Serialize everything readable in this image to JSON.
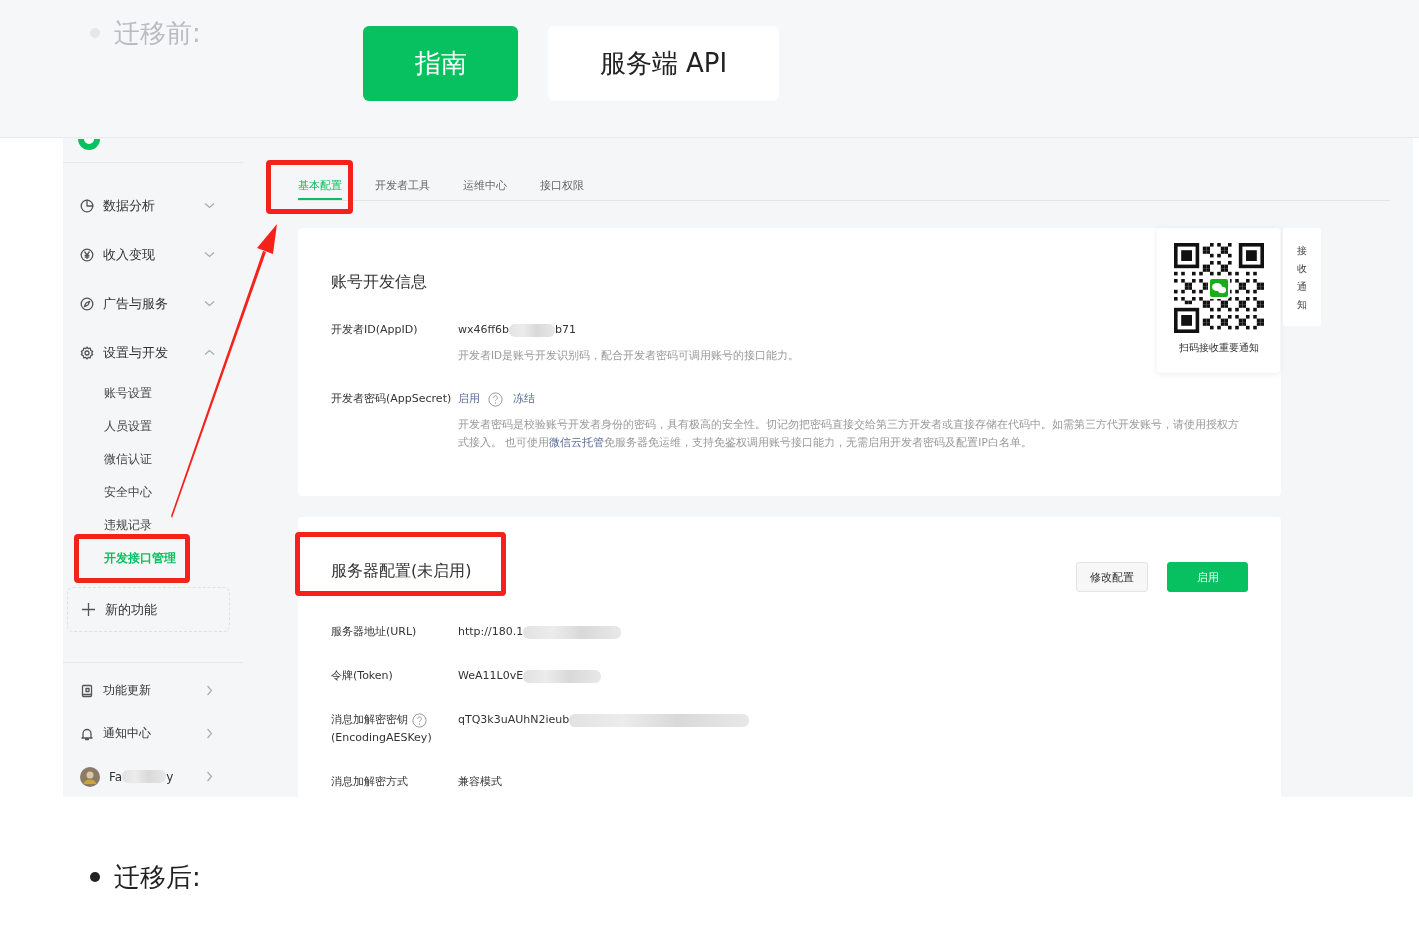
{
  "doc": {
    "bullet_before": "迁移前:",
    "bullet_after": "迁移后:"
  },
  "header_tabs": [
    {
      "label": "指南",
      "selected": true
    },
    {
      "label": "服务端 API",
      "selected": false
    }
  ],
  "screenshot": {
    "nav": [
      {
        "label": "数据分析",
        "expanded": false
      },
      {
        "label": "收入变现",
        "expanded": false
      },
      {
        "label": "广告与服务",
        "expanded": false
      },
      {
        "label": "设置与开发",
        "expanded": true,
        "children": [
          {
            "label": "账号设置",
            "selected": false
          },
          {
            "label": "人员设置",
            "selected": false
          },
          {
            "label": "微信认证",
            "selected": false
          },
          {
            "label": "安全中心",
            "selected": false
          },
          {
            "label": "违规记录",
            "selected": false
          },
          {
            "label": "开发接口管理",
            "selected": true
          }
        ]
      }
    ],
    "new_feature": "新的功能",
    "footer_nav": [
      {
        "kind": "book",
        "label": "功能更新"
      },
      {
        "kind": "bell",
        "label": "通知中心"
      },
      {
        "kind": "avatar",
        "label": "Fa",
        "label_end": "y",
        "redacted": true
      }
    ],
    "tabs": [
      {
        "label": "基本配置",
        "selected": true
      },
      {
        "label": "开发者工具",
        "selected": false
      },
      {
        "label": "运维中心",
        "selected": false
      },
      {
        "label": "接口权限",
        "selected": false
      }
    ],
    "account_card": {
      "title": "账号开发信息",
      "rows": [
        {
          "kind": "text",
          "label": "开发者ID(AppID)",
          "value": "wx46ff6b",
          "redacted": true,
          "value_end": "b71",
          "note": "开发者ID是账号开发识别码，配合开发者密码可调用账号的接口能力。"
        },
        {
          "kind": "links",
          "label": "开发者密码(AppSecret)",
          "links": [
            "启用",
            "冻结"
          ],
          "help": true,
          "note": "开发者密码是校验账号开发者身份的密码，具有极高的安全性。切记勿把密码直接交给第三方开发者或直接存储在代码中。如需第三方代开发账号，请使用授权方式接入。 也可使用",
          "note_link": "微信云托管",
          "note_end": "免服务器免运维，支持免鉴权调用账号接口能力，无需启用开发者密码及配置IP白名单。"
        }
      ]
    },
    "server_card": {
      "title": "服务器配置(未启用)",
      "buttons": [
        {
          "label": "修改配置",
          "primary": false
        },
        {
          "label": "启用",
          "primary": true
        }
      ],
      "rows": [
        {
          "kind": "text",
          "label": "服务器地址(URL)",
          "value": "http://180.1",
          "redacted": true
        },
        {
          "kind": "text",
          "label": "令牌(Token)",
          "value": "WeA11L0vE",
          "redacted": true
        },
        {
          "kind": "text",
          "label": "消息加解密密钥",
          "help": true,
          "label_2": "(EncodingAESKey)",
          "value": "qTQ3k3uAUhN2ieub",
          "redacted": true
        },
        {
          "kind": "text",
          "label": "消息加解密方式",
          "value": "兼容模式",
          "redacted": false
        }
      ]
    },
    "qr_popup": {
      "caption": "扫码接收重要通知"
    },
    "side_tab": "接收通知"
  }
}
